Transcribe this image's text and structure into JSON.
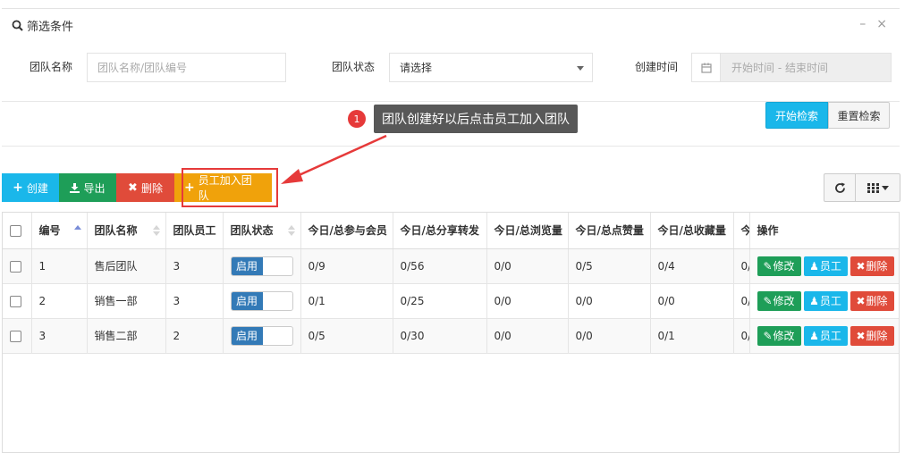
{
  "filter": {
    "title": "筛选条件",
    "minimize_icon": "minus-icon",
    "close_icon": "close-icon",
    "team_name_label": "团队名称",
    "team_name_placeholder": "团队名称/团队编号",
    "team_status_label": "团队状态",
    "team_status_value": "请选择",
    "create_time_label": "创建时间",
    "create_time_placeholder": "开始时间 - 结束时间",
    "search_button": "开始检索",
    "reset_button": "重置检索"
  },
  "tip": {
    "badge": "1",
    "text": "团队创建好以后点击员工加入团队"
  },
  "toolbar": {
    "create": "创建",
    "export": "导出",
    "delete": "删除",
    "join": "员工加入团队"
  },
  "colors": {
    "primary": "#1ab7ea",
    "success": "#1e9e58",
    "danger": "#e04b3a",
    "warning": "#f0a20b",
    "highlight": "#e63a3a",
    "toggle_on": "#337ab7"
  },
  "table": {
    "headers": [
      "编号",
      "团队名称",
      "团队员工",
      "团队状态",
      "今日/总参与会员",
      "今日/总分享转发",
      "今日/总浏览量",
      "今日/总点赞量",
      "今日/总收藏量",
      "今",
      "操作"
    ],
    "rows": [
      {
        "id": "1",
        "name": "售后团队",
        "staff": "3",
        "status": "启用",
        "members": "0/9",
        "shares": "0/56",
        "views": "0/0",
        "likes": "0/5",
        "favorites": "0/4",
        "extra": "0/"
      },
      {
        "id": "2",
        "name": "销售一部",
        "staff": "3",
        "status": "启用",
        "members": "0/1",
        "shares": "0/25",
        "views": "0/0",
        "likes": "0/0",
        "favorites": "0/0",
        "extra": "0/"
      },
      {
        "id": "3",
        "name": "销售二部",
        "staff": "2",
        "status": "启用",
        "members": "0/5",
        "shares": "0/30",
        "views": "0/0",
        "likes": "0/0",
        "favorites": "0/1",
        "extra": "0/"
      }
    ],
    "actions": {
      "edit": "修改",
      "staff": "员工",
      "delete": "删除"
    }
  }
}
